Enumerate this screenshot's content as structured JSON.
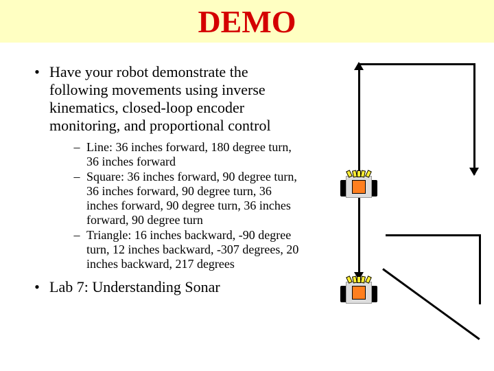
{
  "title": "DEMO",
  "bullets": [
    {
      "text": "Have your robot demonstrate the following movements using inverse kinematics, closed-loop encoder monitoring, and proportional control",
      "subs": [
        "Line: 36 inches forward, 180 degree turn, 36 inches forward",
        "Square: 36 inches forward, 90 degree turn, 36 inches forward, 90 degree turn, 36 inches forward, 90 degree turn, 36 inches forward, 90 degree turn",
        "Triangle: 16 inches backward, -90 degree turn, 12 inches backward, -307 degrees, 20 inches backward, 217 degrees"
      ]
    },
    {
      "text": "Lab 7: Understanding Sonar",
      "subs": []
    }
  ]
}
